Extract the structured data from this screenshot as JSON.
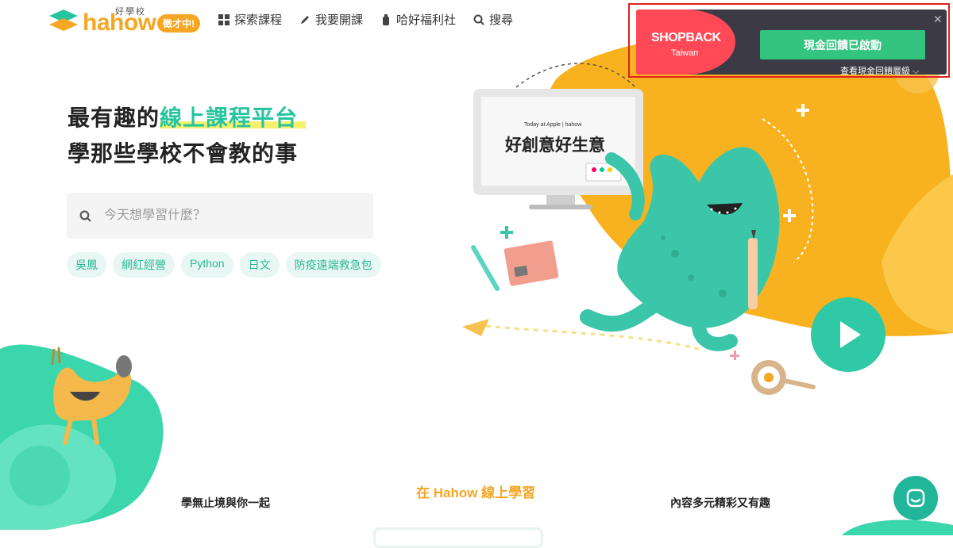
{
  "logo": {
    "brand": "hahow",
    "sub": "好學校",
    "badge": "徵才中!"
  },
  "nav": [
    {
      "label": "探索課程",
      "icon": "grid-icon"
    },
    {
      "label": "我要開課",
      "icon": "pencil-icon"
    },
    {
      "label": "哈好福利社",
      "icon": "bottle-icon"
    },
    {
      "label": "搜尋",
      "icon": "search-icon"
    }
  ],
  "hero": {
    "line1_pre": "最有趣的",
    "line1_hl": "線上課程平台",
    "line2": "學那些學校不會教的事"
  },
  "search": {
    "placeholder": "今天想學習什麼？"
  },
  "tags": [
    "吳鳳",
    "網紅經營",
    "Python",
    "日文",
    "防疫遠端救急包"
  ],
  "illustration": {
    "screen_brand": "Today at Apple | hahow",
    "screen_title": "好創意好生意"
  },
  "bottom": {
    "left": "學無止境與你一起",
    "mid": "在 Hahow 線上學習",
    "right": "內容多元精彩又有趣"
  },
  "shopback": {
    "brand": "SHOPBACK",
    "country": "Taiwan",
    "button": "現金回饋已啟動",
    "link": "查看現金回饋層級"
  },
  "colors": {
    "accent": "#27c4a0",
    "orange": "#f5a623",
    "shopback_red": "#ff4956",
    "shopback_green": "#33c47f"
  }
}
